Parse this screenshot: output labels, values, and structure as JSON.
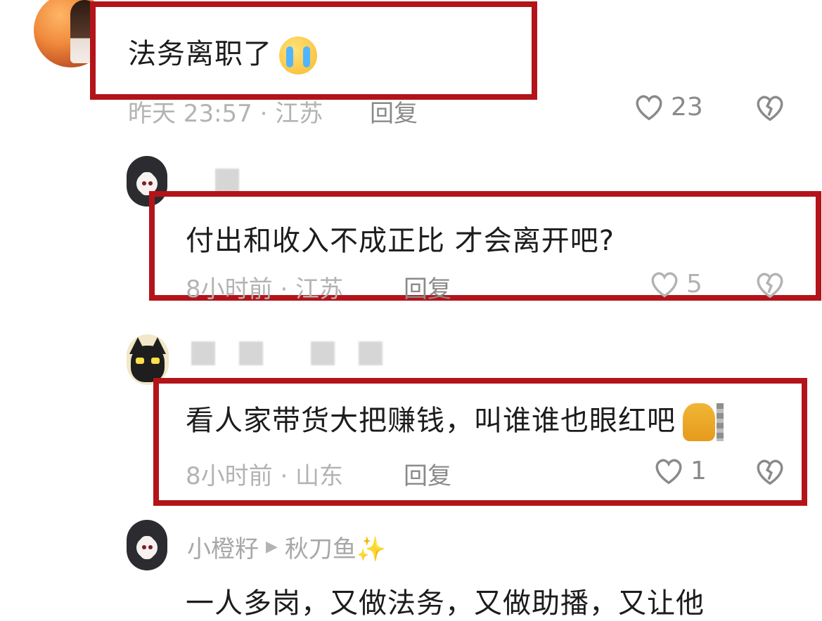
{
  "colors": {
    "highlight_red": "#b3141a",
    "meta_gray": "#b3b3b3",
    "text": "#1c1c1c"
  },
  "comments": [
    {
      "text": "法务离职了",
      "emoji": "loudly-crying-face",
      "meta": "昨天 23:57 · 江苏",
      "reply_label": "回复",
      "likes": "23"
    },
    {
      "text": "付出和收入不成正比 才会离开吧?",
      "meta": "8小时前 · 江苏",
      "reply_label": "回复",
      "likes": "5"
    },
    {
      "text": "看人家带货大把赚钱，叫谁谁也眼红吧",
      "emoji": "cat-peeking",
      "meta": "8小时前 · 山东",
      "reply_label": "回复",
      "likes": "1"
    },
    {
      "author": "小橙籽",
      "reply_to": "秋刀鱼✨",
      "text": "一人多岗，又做法务，又做助播，又让他"
    }
  ]
}
